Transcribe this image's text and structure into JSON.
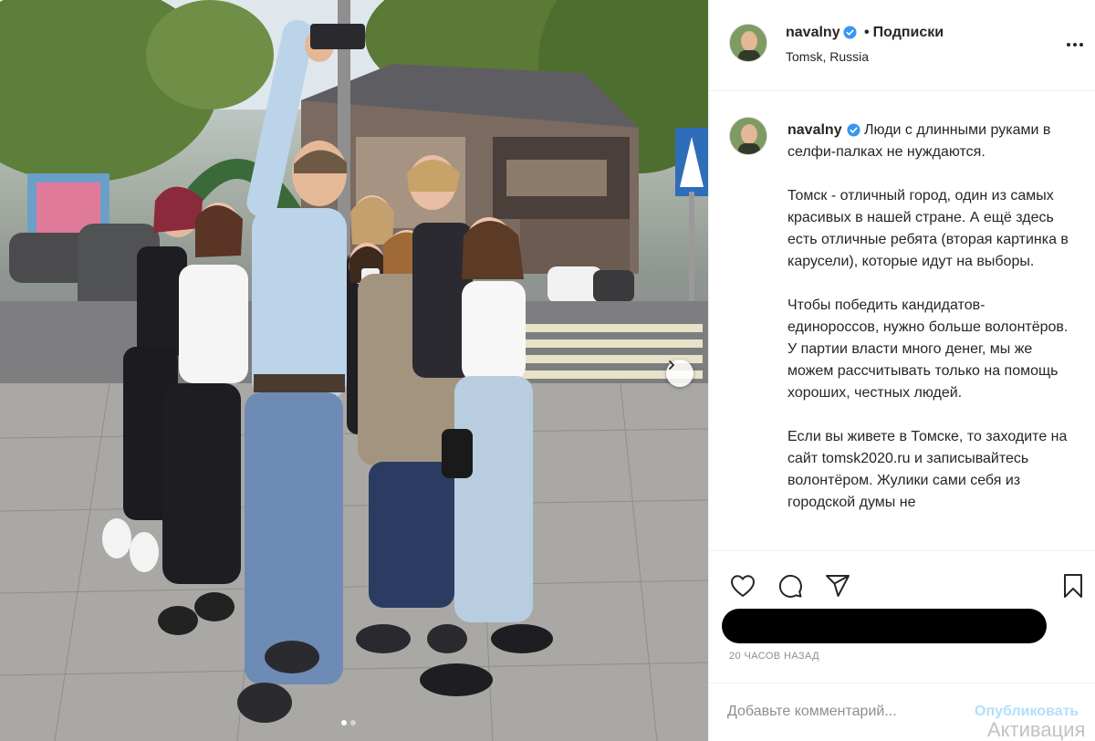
{
  "post": {
    "photo_alt": "",
    "carousel_dots": 2,
    "active_dot": 0
  },
  "header": {
    "username": "navalny",
    "separator": "•",
    "follow_label": "Подписки",
    "location": "Tomsk, Russia",
    "more_icon": "more-horizontal-icon"
  },
  "caption": {
    "username": "navalny",
    "text": "Люди с длинными руками в селфи-палках не нуждаются.\n\nТомск - отличный город, один из самых красивых в нашей стране. А ещё здесь есть отличные ребята (вторая картинка в карусели), которые идут на выборы.\n\nЧтобы победить кандидатов-единороссов, нужно больше волонтёров. У партии власти много денег, мы же можем рассчитывать только на помощь хороших, честных людей.\n\nЕсли вы живете в Томске, то заходите на сайт tomsk2020.ru и записывайтесь волонтёром. Жулики сами себя из городской думы не"
  },
  "actions": {
    "like_icon": "heart-icon",
    "comment_icon": "comment-icon",
    "share_icon": "paper-plane-icon",
    "save_icon": "bookmark-icon"
  },
  "timestamp": "20 часов назад",
  "comment": {
    "placeholder": "Добавьте комментарий...",
    "post_label": "Опубликовать"
  },
  "os_watermark": "Активация",
  "colors": {
    "verified_badge": "#3897f0",
    "post_button_disabled": "#b2dffc",
    "secondary_text": "#8e8e8e",
    "border": "#efefef"
  }
}
